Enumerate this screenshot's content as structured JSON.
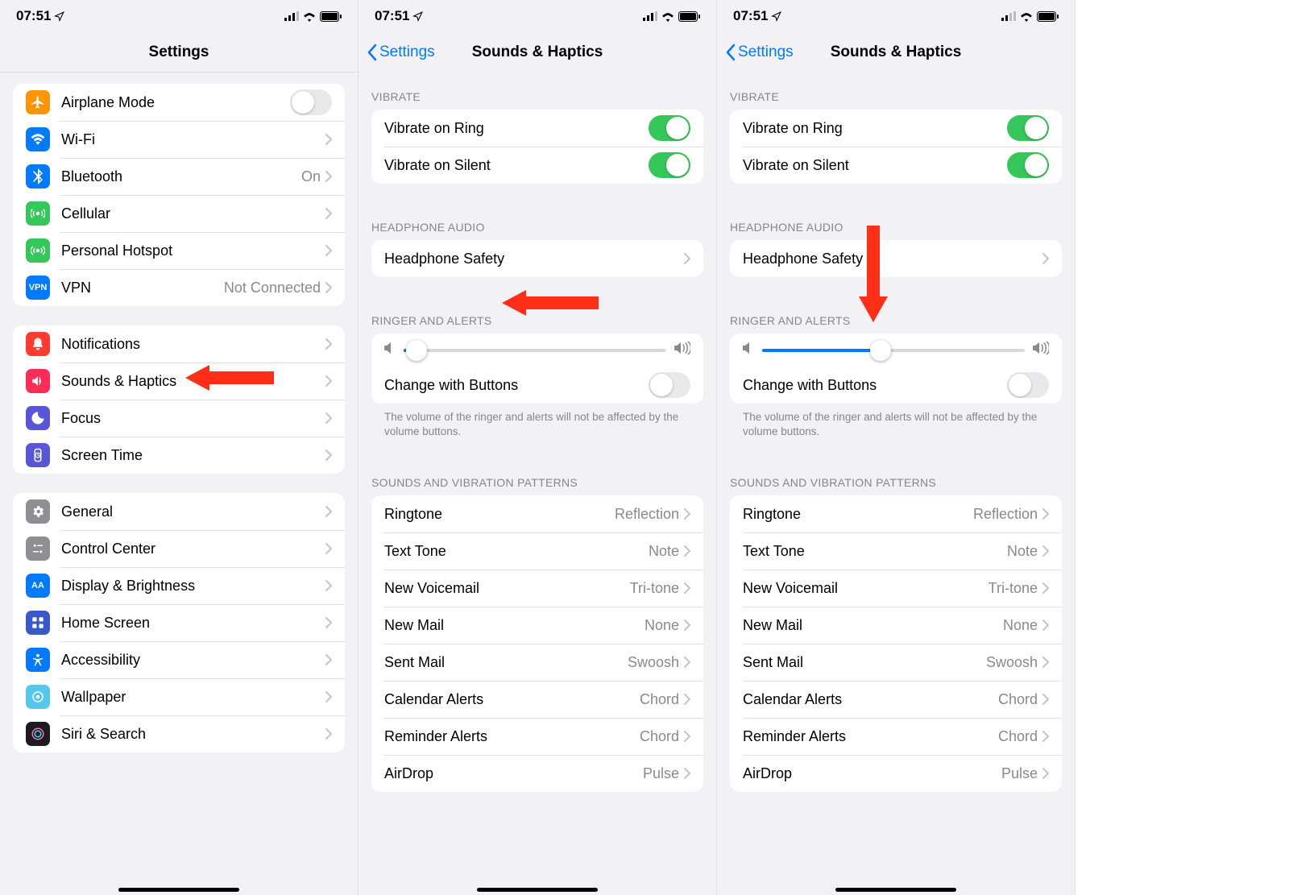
{
  "status": {
    "time": "07:51"
  },
  "panel1": {
    "title": "Settings",
    "group1": {
      "items": [
        {
          "name": "airplane",
          "label": "Airplane Mode",
          "icon_bg": "#ff9500",
          "type": "toggle",
          "on": false
        },
        {
          "name": "wifi",
          "label": "Wi-Fi",
          "icon_bg": "#007aff",
          "type": "chevron",
          "value": ""
        },
        {
          "name": "bluetooth",
          "label": "Bluetooth",
          "icon_bg": "#007aff",
          "type": "chevron",
          "value": "On"
        },
        {
          "name": "cellular",
          "label": "Cellular",
          "icon_bg": "#34c759",
          "type": "chevron",
          "value": ""
        },
        {
          "name": "hotspot",
          "label": "Personal Hotspot",
          "icon_bg": "#34c759",
          "type": "chevron",
          "value": ""
        },
        {
          "name": "vpn",
          "label": "VPN",
          "icon_bg": "#007aff",
          "icon_text": "VPN",
          "type": "chevron",
          "value": "Not Connected"
        }
      ]
    },
    "group2": {
      "items": [
        {
          "name": "notifications",
          "label": "Notifications",
          "icon_bg": "#ff3b30",
          "type": "chevron"
        },
        {
          "name": "sounds",
          "label": "Sounds & Haptics",
          "icon_bg": "#ff2d55",
          "type": "chevron"
        },
        {
          "name": "focus",
          "label": "Focus",
          "icon_bg": "#5856d6",
          "type": "chevron"
        },
        {
          "name": "screentime",
          "label": "Screen Time",
          "icon_bg": "#5856d6",
          "type": "chevron"
        }
      ]
    },
    "group3": {
      "items": [
        {
          "name": "general",
          "label": "General",
          "icon_bg": "#8e8e93",
          "type": "chevron"
        },
        {
          "name": "controlcenter",
          "label": "Control Center",
          "icon_bg": "#8e8e93",
          "type": "chevron"
        },
        {
          "name": "display",
          "label": "Display & Brightness",
          "icon_bg": "#007aff",
          "icon_text": "AA",
          "type": "chevron"
        },
        {
          "name": "homescreen",
          "label": "Home Screen",
          "icon_bg": "#3859c7",
          "type": "chevron"
        },
        {
          "name": "accessibility",
          "label": "Accessibility",
          "icon_bg": "#007aff",
          "type": "chevron"
        },
        {
          "name": "wallpaper",
          "label": "Wallpaper",
          "icon_bg": "#54c7ec",
          "type": "chevron"
        },
        {
          "name": "siri",
          "label": "Siri & Search",
          "icon_bg": "#1c1c1e",
          "type": "chevron"
        }
      ]
    }
  },
  "panel2": {
    "back_label": "Settings",
    "title": "Sounds & Haptics",
    "vibrate_header": "VIBRATE",
    "vibrate_ring": "Vibrate on Ring",
    "vibrate_silent": "Vibrate on Silent",
    "headphone_header": "HEADPHONE AUDIO",
    "headphone_safety": "Headphone Safety",
    "ringer_header": "RINGER AND ALERTS",
    "slider_percent": 5,
    "change_buttons": "Change with Buttons",
    "volume_footer": "The volume of the ringer and alerts will not be affected by the volume buttons.",
    "patterns_header": "SOUNDS AND VIBRATION PATTERNS",
    "patterns": [
      {
        "label": "Ringtone",
        "value": "Reflection"
      },
      {
        "label": "Text Tone",
        "value": "Note"
      },
      {
        "label": "New Voicemail",
        "value": "Tri-tone"
      },
      {
        "label": "New Mail",
        "value": "None"
      },
      {
        "label": "Sent Mail",
        "value": "Swoosh"
      },
      {
        "label": "Calendar Alerts",
        "value": "Chord"
      },
      {
        "label": "Reminder Alerts",
        "value": "Chord"
      },
      {
        "label": "AirDrop",
        "value": "Pulse"
      }
    ]
  },
  "panel3": {
    "back_label": "Settings",
    "title": "Sounds & Haptics",
    "slider_percent": 45
  }
}
